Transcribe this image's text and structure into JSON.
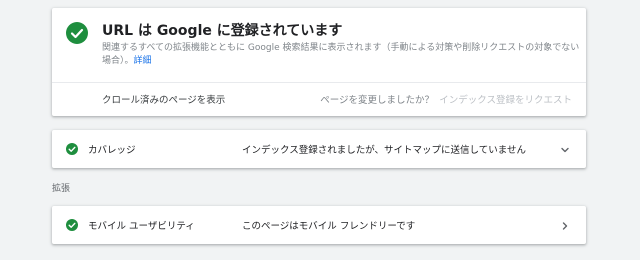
{
  "status": {
    "title": "URL は Google に登録されています",
    "description": "関連するすべての拡張機能とともに Google 検索結果に表示されます（手動による対策や削除リクエストの対象でない場合）。",
    "details_link": "詳細",
    "view_crawled_page": "クロール済みのページを表示",
    "page_changed_question": "ページを変更しましたか？",
    "request_indexing": "インデックス登録をリクエスト"
  },
  "coverage": {
    "label": "カバレッジ",
    "value": "インデックス登録されましたが、サイトマップに送信していません"
  },
  "enhancements": {
    "heading": "拡張",
    "mobile_usability": {
      "label": "モバイル ユーザビリティ",
      "value": "このページはモバイル フレンドリーです"
    }
  },
  "colors": {
    "success_green": "#1e8e3e",
    "link_blue": "#1a73e8",
    "disabled_text": "#bdc1c6"
  },
  "icons": {
    "status_check": "check-circle-icon",
    "coverage_check": "check-circle-icon",
    "coverage_expand": "chevron-down-icon",
    "mobile_check": "check-circle-icon",
    "mobile_open": "chevron-right-icon"
  }
}
